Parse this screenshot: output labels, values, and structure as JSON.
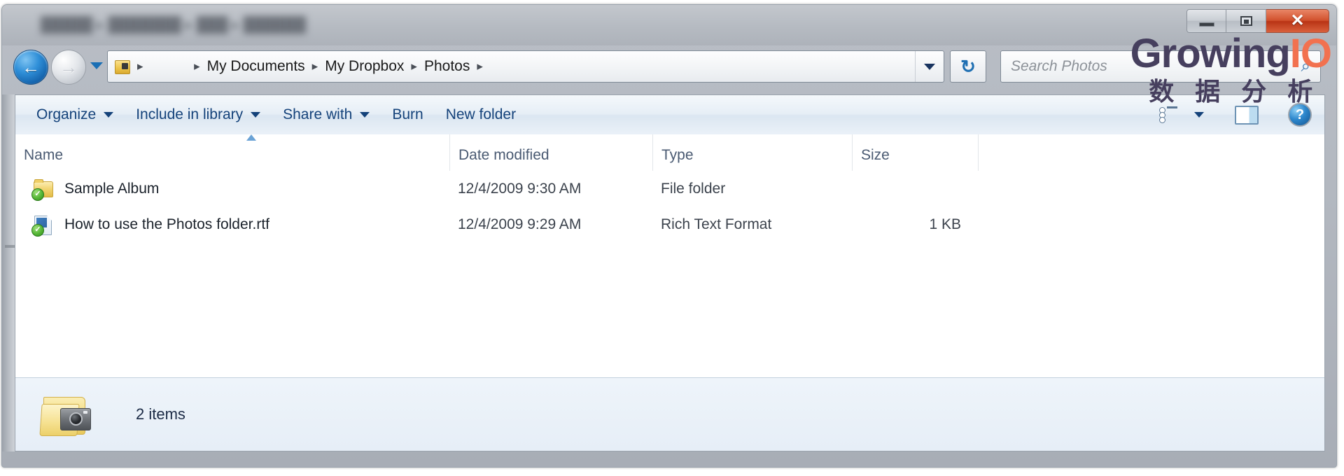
{
  "window": {
    "title_redacted": "█████ ▸ ███████ ▸ ███ ▸ ██████",
    "controls": {
      "minimize_label": "—",
      "maximize_label": "□",
      "close_label": "✕"
    }
  },
  "navigation": {
    "back_label": "←",
    "forward_label": "→",
    "recent_locations_label": "▼"
  },
  "address_bar": {
    "crumbs": [
      {
        "label": "",
        "blurred": true
      },
      {
        "label": "My Documents",
        "blurred": false
      },
      {
        "label": "My Dropbox",
        "blurred": false
      },
      {
        "label": "Photos",
        "blurred": false
      }
    ],
    "separator": "▸",
    "dropdown_label": "▼",
    "refresh_label": "↻"
  },
  "search": {
    "placeholder": "Search Photos",
    "value": "",
    "icon_label": "⌕"
  },
  "toolbar": {
    "items": [
      {
        "label": "Organize",
        "has_caret": true
      },
      {
        "label": "Include in library",
        "has_caret": true
      },
      {
        "label": "Share with",
        "has_caret": true
      },
      {
        "label": "Burn",
        "has_caret": false
      },
      {
        "label": "New folder",
        "has_caret": false
      }
    ],
    "view_caret_label": "▼",
    "help_label": "?"
  },
  "columns": [
    {
      "key": "name",
      "label": "Name",
      "sorted": true,
      "sort_direction": "asc"
    },
    {
      "key": "date",
      "label": "Date modified",
      "sorted": false
    },
    {
      "key": "type",
      "label": "Type",
      "sorted": false
    },
    {
      "key": "size",
      "label": "Size",
      "sorted": false
    }
  ],
  "files": [
    {
      "name": "Sample Album",
      "date_modified": "12/4/2009 9:30 AM",
      "type": "File folder",
      "size": "",
      "icon": "folder-icon",
      "sync_badge": "✓"
    },
    {
      "name": "How to use the Photos folder.rtf",
      "date_modified": "12/4/2009 9:29 AM",
      "type": "Rich Text Format",
      "size": "1 KB",
      "icon": "rtf-document-icon",
      "sync_badge": "✓"
    }
  ],
  "status_bar": {
    "item_count_label": "2 items",
    "icon": "photos-folder-icon"
  },
  "watermark": {
    "brand_part1": "Growing",
    "brand_part2": "IO",
    "subtitle": "数 据 分 析",
    "color_brand": "#463f5e",
    "color_accent": "#f2714f"
  }
}
